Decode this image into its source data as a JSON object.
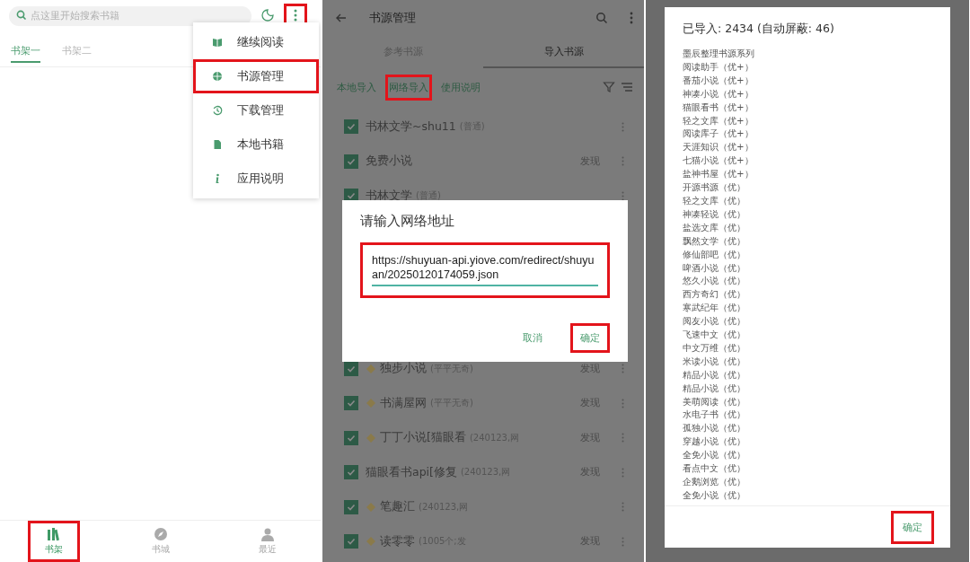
{
  "bookshelf_screen": {
    "search": {
      "placeholder": "点这里开始搜索书籍"
    },
    "more_button": {
      "highlighted": true
    },
    "tabs": [
      {
        "label": "书架一",
        "selected": true
      },
      {
        "label": "书架二",
        "selected": false
      }
    ],
    "menu": [
      {
        "label": "继续阅读",
        "kind": "continue",
        "highlighted": false
      },
      {
        "label": "书源管理",
        "kind": "sources",
        "highlighted": true
      },
      {
        "label": "下载管理",
        "kind": "downloads",
        "highlighted": false
      },
      {
        "label": "本地书籍",
        "kind": "local",
        "highlighted": false
      },
      {
        "label": "应用说明",
        "kind": "about",
        "highlighted": false
      }
    ],
    "bottom_nav": [
      {
        "label": "书架",
        "kind": "shelf",
        "selected": true,
        "highlighted": true
      },
      {
        "label": "书城",
        "kind": "store",
        "selected": false,
        "highlighted": false
      },
      {
        "label": "最近",
        "kind": "recent",
        "selected": false,
        "highlighted": false
      }
    ]
  },
  "source_screen": {
    "title": "书源管理",
    "tabs": [
      {
        "label": "参考书源",
        "selected": false
      },
      {
        "label": "导入书源",
        "selected": true
      }
    ],
    "actions": [
      {
        "label": "本地导入",
        "highlighted": false
      },
      {
        "label": "网络导入",
        "highlighted": true
      },
      {
        "label": "使用说明",
        "highlighted": false
      }
    ],
    "sources": [
      {
        "name": "书林文学~shu11",
        "note": "(普通)",
        "checked": true,
        "kind": "plain"
      },
      {
        "name": "免费小说",
        "discover": "发现",
        "checked": true,
        "kind": "plain"
      },
      {
        "name": "书林文学",
        "note": "(普通)",
        "checked": true,
        "kind": "plain"
      },
      {
        "name": "独步小说",
        "note": "(平平无奇)",
        "discover": "发现",
        "checked": true,
        "kind": "icon"
      },
      {
        "name": "书满屋网",
        "note": "(平平无奇)",
        "discover": "发现",
        "checked": true,
        "kind": "icon"
      },
      {
        "name": "丁丁小说[猫眼看",
        "note": "(240123,网",
        "discover": "发现",
        "checked": true,
        "kind": "icon"
      },
      {
        "name": "猫眼看书api[修复",
        "note": "(240123,网",
        "discover": "发现",
        "checked": true,
        "kind": "plain"
      },
      {
        "name": "笔趣汇",
        "note": "(240123,网",
        "checked": true,
        "kind": "icon"
      },
      {
        "name": "读零零",
        "note": "(1005个;发",
        "discover": "发现",
        "checked": true,
        "kind": "icon"
      }
    ],
    "dialog": {
      "title": "请输入网络地址",
      "url": "https://shuyuan-api.yiove.com/redirect/shuyuan/20250120174059.json",
      "url_highlighted": true,
      "buttons": [
        {
          "label": "取消",
          "highlighted": false
        },
        {
          "label": "确定",
          "highlighted": true
        }
      ]
    }
  },
  "import_result_dialog": {
    "title": "已导入: 2434 (自动屏蔽: 46)",
    "lines": [
      "墨辰整理书源系列",
      "阅读助手（优+）",
      "番茄小说（优+）",
      "神凑小说（优+）",
      "猫眼看书（优+）",
      "轻之文库（优+）",
      "阅读库子（优+）",
      "天涯知识（优+）",
      "七猫小说（优+）",
      "盐神书屋（优+）",
      "开源书源（优）",
      "轻之文库（优）",
      "神凑轻说（优）",
      "盐选文库（优）",
      "飘然文学（优）",
      "修仙部吧（优）",
      "啤酒小说（优）",
      "悠久小说（优）",
      "西方奇幻（优）",
      "寒武纪年（优）",
      "阅友小说（优）",
      "飞速中文（优）",
      "中文万维（优）",
      "米读小说（优）",
      "精品小说（优）",
      "精品小说（优）",
      "美萌阅读（优）",
      "水电子书（优）",
      "孤独小说（优）",
      "穿越小说（优）",
      "全免小说（优）",
      "看点中文（优）",
      "企鹅浏览（优）",
      "全免小说（优）"
    ],
    "button": {
      "label": "确定",
      "highlighted": true
    }
  }
}
